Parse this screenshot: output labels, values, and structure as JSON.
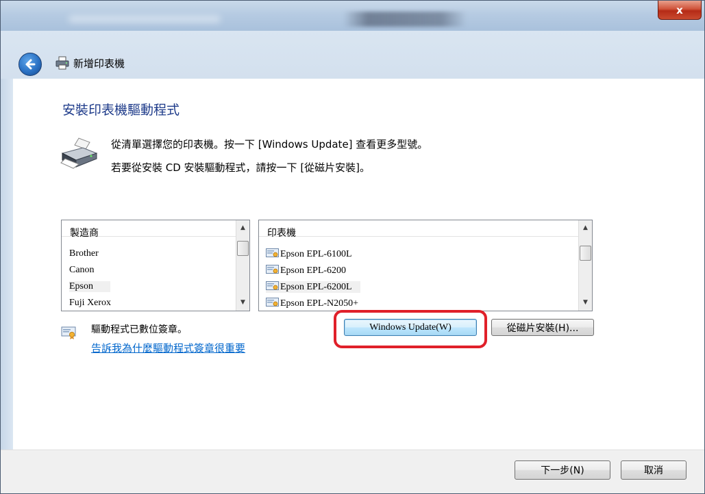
{
  "window": {
    "close_label": "x"
  },
  "nav": {
    "title": "新增印表機"
  },
  "page": {
    "heading": "安裝印表機驅動程式",
    "instruction_line1": "從清單選擇您的印表機。按一下 [Windows Update] 查看更多型號。",
    "instruction_line2": "若要從安裝 CD 安裝驅動程式，請按一下 [從磁片安裝]。"
  },
  "manufacturers": {
    "header": "製造商",
    "items": [
      "Brother",
      "Canon",
      "Epson",
      "Fuji Xerox"
    ],
    "selected": "Epson"
  },
  "printers": {
    "header": "印表機",
    "items": [
      "Epson EPL-6100L",
      "Epson EPL-6200",
      "Epson EPL-6200L",
      "Epson EPL-N2050+"
    ],
    "selected": "Epson EPL-6200L"
  },
  "signature": {
    "text": "驅動程式已數位簽章。",
    "link": "告訴我為什麼驅動程式簽章很重要"
  },
  "buttons": {
    "windows_update": "Windows Update(W)",
    "have_disk": "從磁片安裝(H)...",
    "next": "下一步(N)",
    "cancel": "取消"
  },
  "colors": {
    "heading": "#1e3b8a",
    "link": "#0066cc",
    "highlight": "#e0202a"
  }
}
